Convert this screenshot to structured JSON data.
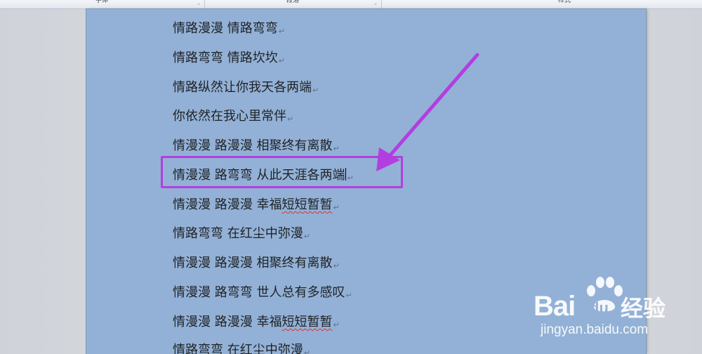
{
  "ribbon": {
    "groups": [
      {
        "label": "字体"
      },
      {
        "label": "段落"
      },
      {
        "label": "样式"
      }
    ]
  },
  "document": {
    "lines": [
      {
        "text": "情路漫漫 情路弯弯"
      },
      {
        "text": "情路弯弯 情路坎坎"
      },
      {
        "text": "情路纵然让你我天各两端"
      },
      {
        "text": "你依然在我心里常伴"
      },
      {
        "text": "情漫漫 路漫漫 相聚终有离散"
      },
      {
        "text": "情漫漫 路弯弯 从此天涯各两端"
      },
      {
        "text_a": "情漫漫 路漫漫 幸福",
        "text_b": "短短暂暂"
      },
      {
        "text": "情路弯弯 在红尘中弥漫"
      },
      {
        "text": "情漫漫 路漫漫 相聚终有离散"
      },
      {
        "text": "情漫漫 路弯弯 世人总有多感叹"
      },
      {
        "text_a": "情漫漫 路漫漫 幸福",
        "text_b": "短短暂暂"
      },
      {
        "text": "情路弯弯 在红尘中弥漫"
      }
    ],
    "paragraph_mark": "↵"
  },
  "annotation": {
    "color": "#b23ee0"
  },
  "watermark": {
    "brand_latin": "Bai",
    "brand_du": "du",
    "brand_cn": "经验",
    "url": "jingyan.baidu.com"
  },
  "colors": {
    "page": "#93b1d6",
    "accent": "#b23ee0"
  }
}
